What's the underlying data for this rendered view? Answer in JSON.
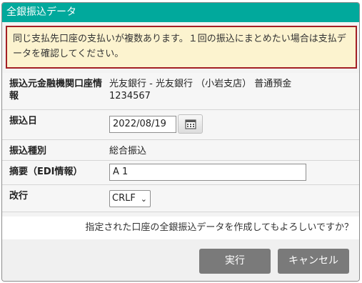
{
  "dialog": {
    "title": "全銀振込データ",
    "alert": "同じ支払先口座の支払いが複数あります。１回の振込にまとめたい場合は支払データを確認してください。"
  },
  "form": {
    "bank_account": {
      "label": "振込元金融機関口座情報",
      "value_line1": "光友銀行 - 光友銀行 （小岩支店） 普通預金",
      "value_line2": "1234567"
    },
    "transfer_date": {
      "label": "振込日",
      "value": "2022/08/19",
      "icon": "calendar-icon"
    },
    "transfer_type": {
      "label": "振込種別",
      "value": "総合振込"
    },
    "summary": {
      "label": "摘要（EDI情報）",
      "value": "A 1"
    },
    "line_feed": {
      "label": "改行",
      "selected": "CRLF"
    }
  },
  "confirm_message": "指定された口座の全銀振込データを作成してもよろしいですか？",
  "buttons": {
    "execute": "実行",
    "cancel": "キャンセル"
  },
  "colors": {
    "title_bar": "#01a99c",
    "alert_bg": "#fcf3cf",
    "alert_border": "#a31f24",
    "button": "#7a7a7a"
  }
}
